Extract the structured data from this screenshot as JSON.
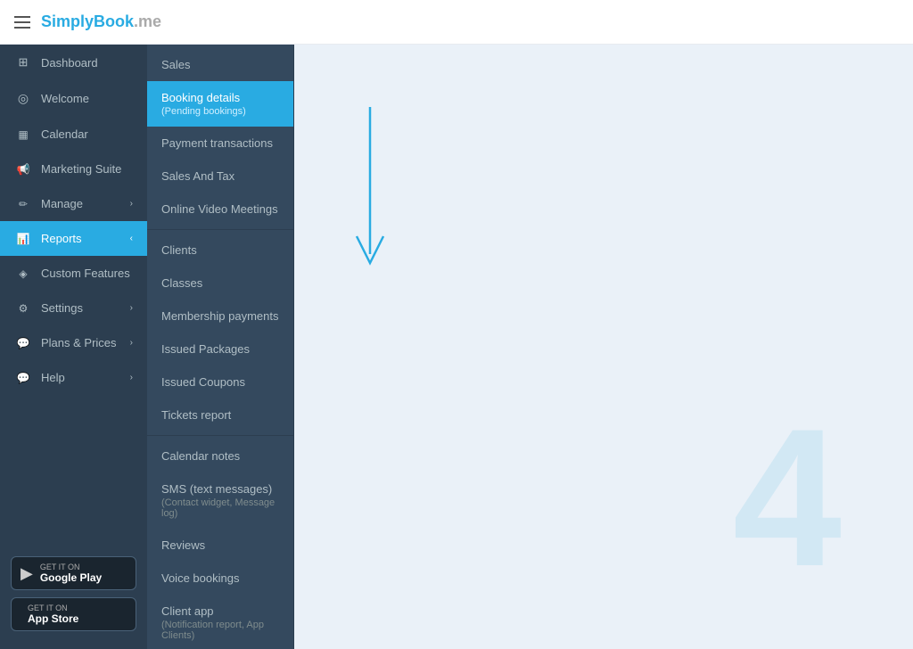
{
  "header": {
    "logo": {
      "simply": "Simply",
      "book": "Book",
      "me": ".me"
    }
  },
  "sidebar": {
    "items": [
      {
        "id": "dashboard",
        "label": "Dashboard",
        "icon": "⊞",
        "active": false,
        "hasChevron": false
      },
      {
        "id": "welcome",
        "label": "Welcome",
        "icon": "◎",
        "active": false,
        "hasChevron": false
      },
      {
        "id": "calendar",
        "label": "Calendar",
        "icon": "📅",
        "active": false,
        "hasChevron": false
      },
      {
        "id": "marketing",
        "label": "Marketing Suite",
        "icon": "📢",
        "active": false,
        "hasChevron": false
      },
      {
        "id": "manage",
        "label": "Manage",
        "icon": "✏",
        "active": false,
        "hasChevron": true
      },
      {
        "id": "reports",
        "label": "Reports",
        "icon": "📊",
        "active": true,
        "hasChevron": true
      },
      {
        "id": "custom",
        "label": "Custom Features",
        "icon": "◈",
        "active": false,
        "hasChevron": false
      },
      {
        "id": "settings",
        "label": "Settings",
        "icon": "⚙",
        "active": false,
        "hasChevron": true
      },
      {
        "id": "plans",
        "label": "Plans & Prices",
        "icon": "💬",
        "active": false,
        "hasChevron": true
      },
      {
        "id": "help",
        "label": "Help",
        "icon": "💬",
        "active": false,
        "hasChevron": true
      }
    ],
    "google_play": {
      "small": "GET IT ON",
      "main": "Google Play",
      "icon": "▶"
    },
    "app_store": {
      "small": "GET IT ON",
      "main": "App Store",
      "icon": ""
    }
  },
  "reports_submenu": {
    "sections": [
      {
        "items": [
          {
            "id": "sales",
            "label": "Sales",
            "sub": "",
            "active": false
          },
          {
            "id": "booking-details",
            "label": "Booking details",
            "sub": "(Pending bookings)",
            "active": true
          },
          {
            "id": "payment-transactions",
            "label": "Payment transactions",
            "sub": "",
            "active": false
          },
          {
            "id": "sales-and-tax",
            "label": "Sales And Tax",
            "sub": "",
            "active": false
          },
          {
            "id": "online-video",
            "label": "Online Video Meetings",
            "sub": "",
            "active": false
          }
        ]
      },
      {
        "items": [
          {
            "id": "clients",
            "label": "Clients",
            "sub": "",
            "active": false
          },
          {
            "id": "classes",
            "label": "Classes",
            "sub": "",
            "active": false
          },
          {
            "id": "membership-payments",
            "label": "Membership payments",
            "sub": "",
            "active": false
          },
          {
            "id": "issued-packages",
            "label": "Issued Packages",
            "sub": "",
            "active": false
          },
          {
            "id": "issued-coupons",
            "label": "Issued Coupons",
            "sub": "",
            "active": false
          },
          {
            "id": "tickets-report",
            "label": "Tickets report",
            "sub": "",
            "active": false
          }
        ]
      },
      {
        "items": [
          {
            "id": "calendar-notes",
            "label": "Calendar notes",
            "sub": "",
            "active": false
          },
          {
            "id": "sms",
            "label": "SMS (text messages)",
            "sub": "(Contact widget, Message log)",
            "active": false
          },
          {
            "id": "reviews",
            "label": "Reviews",
            "sub": "",
            "active": false
          },
          {
            "id": "voice-bookings",
            "label": "Voice bookings",
            "sub": "",
            "active": false
          },
          {
            "id": "client-app",
            "label": "Client app",
            "sub": "(Notification report, App Clients)",
            "active": false
          }
        ]
      }
    ]
  },
  "main": {
    "watermark": "4"
  }
}
